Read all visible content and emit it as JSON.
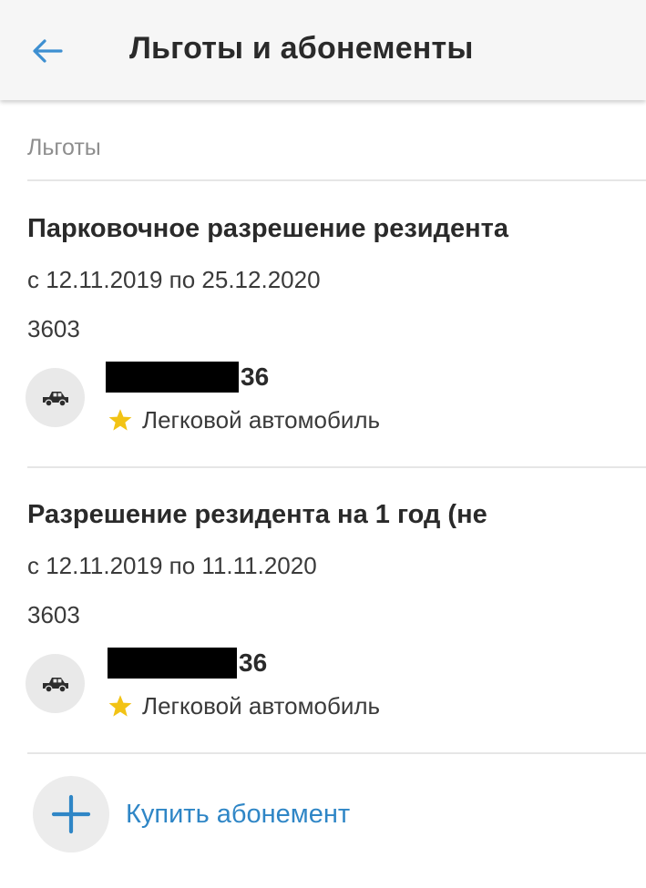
{
  "header": {
    "title": "Льготы и абонементы",
    "back_icon": "arrow-left-icon",
    "accent_color": "#3d8fd1"
  },
  "section": {
    "title": "Льготы"
  },
  "permits": [
    {
      "title": "Парковочное разрешение резидента",
      "dates": "с 12.11.2019 по 25.12.2020",
      "code": "3603",
      "vehicle": {
        "plate_visible": "36",
        "plate_redacted": true,
        "type": "Легковой автомобиль",
        "icon": "car-icon",
        "star_icon": "star-icon",
        "star_color": "#f2c315"
      }
    },
    {
      "title": "Разрешение резидента на 1 год (не",
      "dates": "с 12.11.2019 по 11.11.2020",
      "code": "3603",
      "vehicle": {
        "plate_visible": "36",
        "plate_redacted": true,
        "type": "Легковой автомобиль",
        "icon": "car-icon",
        "star_icon": "star-icon",
        "star_color": "#f2c315"
      }
    }
  ],
  "buy": {
    "label": "Купить абонемент",
    "icon": "plus-icon",
    "color": "#2f86c6"
  }
}
